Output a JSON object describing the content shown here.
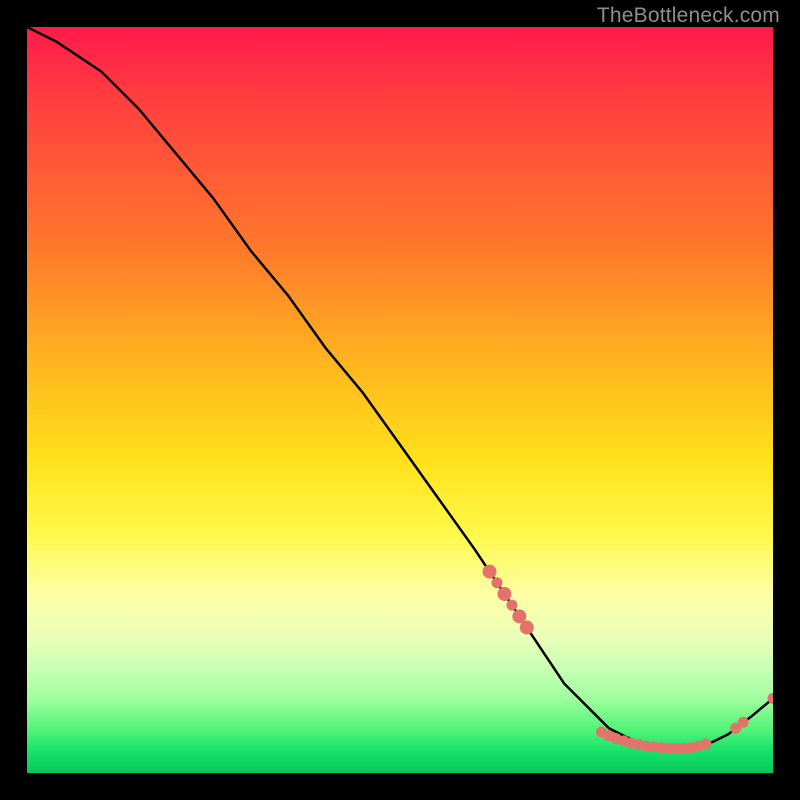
{
  "watermark": "TheBottleneck.com",
  "chart_data": {
    "type": "line",
    "title": "",
    "xlabel": "",
    "ylabel": "",
    "xlim": [
      0,
      100
    ],
    "ylim": [
      0,
      100
    ],
    "grid": false,
    "legend": false,
    "series": [
      {
        "name": "bottleneck-curve",
        "x": [
          0,
          4,
          7,
          10,
          15,
          20,
          25,
          30,
          35,
          40,
          45,
          50,
          55,
          60,
          62,
          64,
          66,
          68,
          70,
          72,
          74,
          76,
          78,
          80,
          82,
          84,
          86,
          88,
          90,
          92,
          94,
          97,
          100
        ],
        "y": [
          100,
          98,
          96,
          94,
          89,
          83,
          77,
          70,
          64,
          57,
          51,
          44,
          37,
          30,
          27,
          24,
          21,
          18,
          15,
          12,
          10,
          8,
          6,
          5,
          4,
          3.5,
          3.3,
          3.3,
          3.6,
          4.2,
          5.2,
          7.5,
          10
        ]
      }
    ],
    "highlight_points": {
      "name": "observed-points",
      "color": "#e2736a",
      "radius_large": 7,
      "radius_small": 5.5,
      "points": [
        {
          "x": 62,
          "y": 27,
          "r": "large"
        },
        {
          "x": 63,
          "y": 25.5,
          "r": "small"
        },
        {
          "x": 64,
          "y": 24,
          "r": "large"
        },
        {
          "x": 65,
          "y": 22.5,
          "r": "small"
        },
        {
          "x": 66,
          "y": 21,
          "r": "large"
        },
        {
          "x": 67,
          "y": 19.5,
          "r": "large"
        },
        {
          "x": 77,
          "y": 5.5,
          "r": "small"
        },
        {
          "x": 78,
          "y": 5,
          "r": "small"
        },
        {
          "x": 79,
          "y": 4.6,
          "r": "small"
        },
        {
          "x": 80,
          "y": 4.3,
          "r": "small"
        },
        {
          "x": 81,
          "y": 4,
          "r": "small"
        },
        {
          "x": 82,
          "y": 3.8,
          "r": "small"
        },
        {
          "x": 83,
          "y": 3.6,
          "r": "small"
        },
        {
          "x": 84,
          "y": 3.5,
          "r": "small"
        },
        {
          "x": 85,
          "y": 3.4,
          "r": "small"
        },
        {
          "x": 86,
          "y": 3.3,
          "r": "small"
        },
        {
          "x": 87,
          "y": 3.3,
          "r": "small"
        },
        {
          "x": 88,
          "y": 3.3,
          "r": "small"
        },
        {
          "x": 89,
          "y": 3.4,
          "r": "small"
        },
        {
          "x": 90,
          "y": 3.6,
          "r": "small"
        },
        {
          "x": 91,
          "y": 3.9,
          "r": "small"
        },
        {
          "x": 95,
          "y": 6,
          "r": "small"
        },
        {
          "x": 96,
          "y": 6.8,
          "r": "small"
        },
        {
          "x": 100,
          "y": 10,
          "r": "small"
        }
      ]
    }
  }
}
